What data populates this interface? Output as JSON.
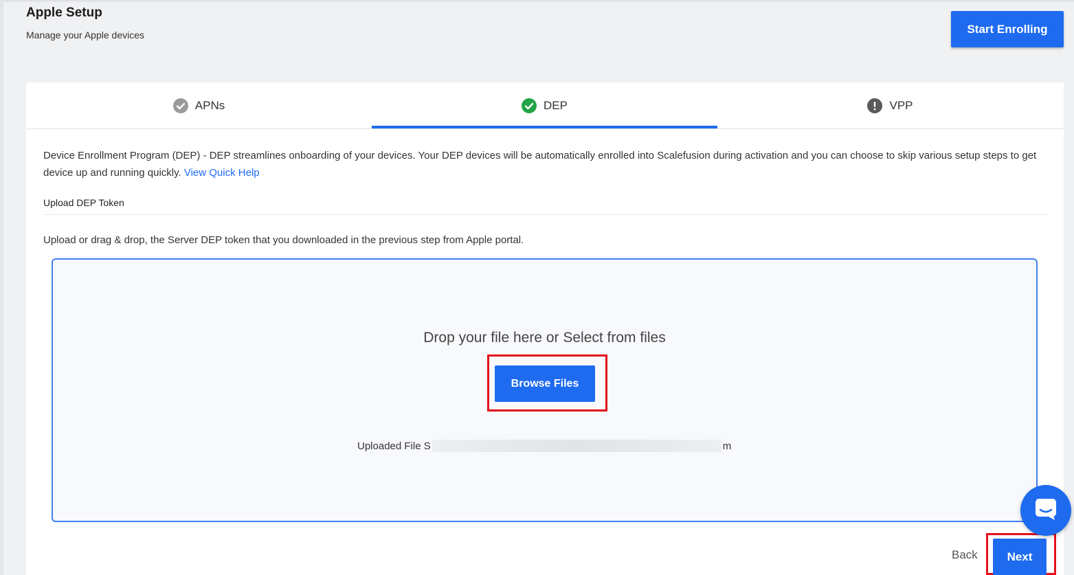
{
  "header": {
    "title": "Apple Setup",
    "subtitle": "Manage your Apple devices",
    "start_button_label": "Start Enrolling"
  },
  "tabs": [
    {
      "label": "APNs",
      "status": "completed-grey"
    },
    {
      "label": "DEP",
      "status": "completed-green",
      "active": true
    },
    {
      "label": "VPP",
      "status": "warning"
    }
  ],
  "dep": {
    "description": "Device Enrollment Program (DEP) - DEP streamlines onboarding of your devices. Your DEP devices will be automatically enrolled into Scalefusion during activation and you can choose to skip various setup steps to get device up and running quickly.",
    "help_link": "View Quick Help",
    "section_label": "Upload DEP Token",
    "upload_hint": "Upload or drag & drop, the Server DEP token that you downloaded in the previous step from Apple portal.",
    "drop_text": "Drop your file here or Select from files",
    "browse_label": "Browse Files",
    "uploaded_prefix": "Uploaded File S",
    "uploaded_suffix": "m"
  },
  "footer": {
    "back_label": "Back",
    "next_label": "Next"
  },
  "colors": {
    "accent": "#1e6bf0",
    "highlight": "#e3101b",
    "check_grey": "#9a9a9a",
    "check_green": "#22a447",
    "warning_dark": "#5a5a5a"
  },
  "icons": {
    "apns_status": "check-circle-icon",
    "dep_status": "check-circle-icon",
    "vpp_status": "exclamation-circle-icon",
    "chat": "chat-bubble-icon"
  }
}
